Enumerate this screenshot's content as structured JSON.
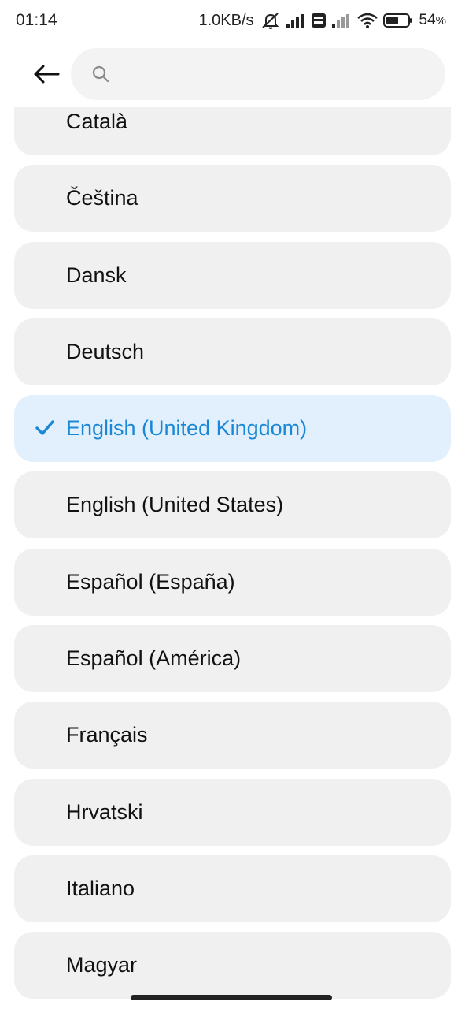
{
  "status_bar": {
    "time": "01:14",
    "net_speed": "1.0KB/s",
    "battery_percent": "54",
    "battery_unit": "%",
    "icons": [
      "mute-icon",
      "signal-icon",
      "volte-icon",
      "signal-icon",
      "wifi-icon",
      "battery-icon"
    ]
  },
  "header": {
    "back_icon": "arrow-left-icon",
    "search": {
      "icon": "search-icon",
      "value": "",
      "placeholder": ""
    }
  },
  "languages": {
    "selected_index": 4,
    "accent_color": "#1a87d6",
    "selected_bg": "#e2f0fd",
    "items": [
      {
        "label": "Català"
      },
      {
        "label": "Čeština"
      },
      {
        "label": "Dansk"
      },
      {
        "label": "Deutsch"
      },
      {
        "label": "English (United Kingdom)",
        "selected": true
      },
      {
        "label": "English (United States)"
      },
      {
        "label": "Español (España)"
      },
      {
        "label": "Español (América)"
      },
      {
        "label": "Français"
      },
      {
        "label": "Hrvatski"
      },
      {
        "label": "Italiano"
      },
      {
        "label": "Magyar"
      }
    ]
  }
}
